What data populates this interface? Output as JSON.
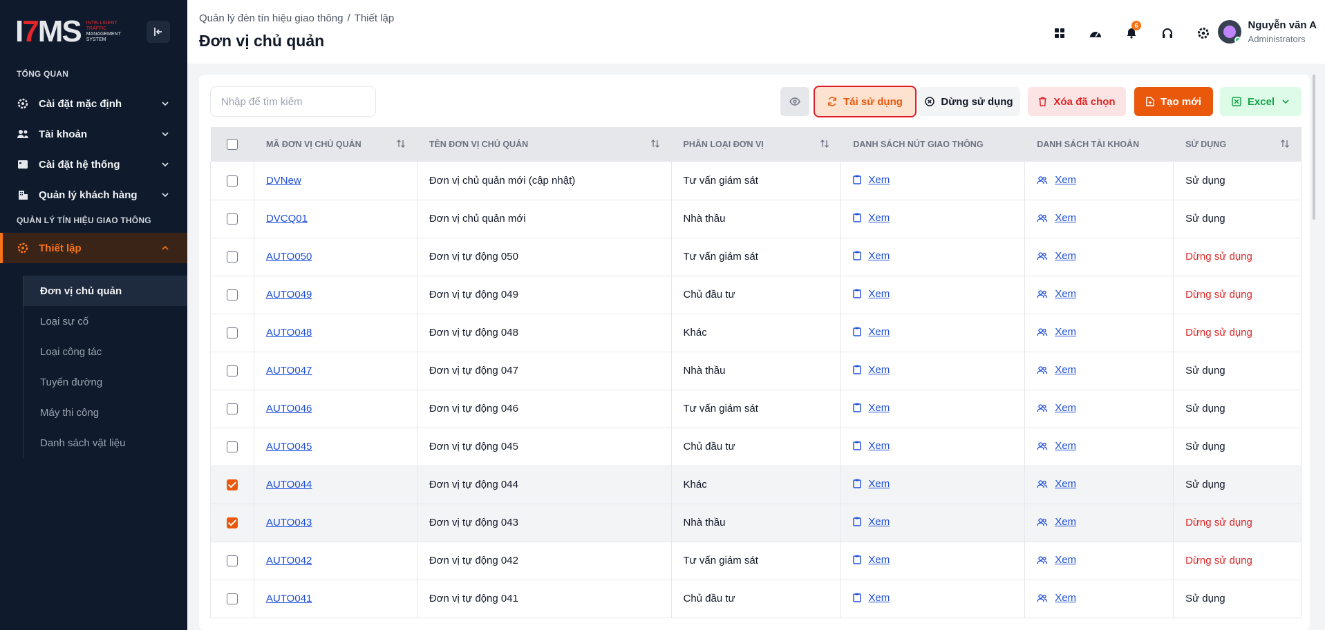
{
  "brand": {
    "logo_text": "ITMS",
    "logo_sub_red": "INTELLIGENT TRAFFIC",
    "logo_sub": "MANAGEMENT SYSTEM"
  },
  "sidebar": {
    "section1": "TỔNG QUAN",
    "items1": [
      {
        "label": "Cài đặt mặc định",
        "icon": "gear-icon"
      },
      {
        "label": "Tài khoản",
        "icon": "users-icon"
      },
      {
        "label": "Cài đặt hệ thống",
        "icon": "window-icon"
      },
      {
        "label": "Quản lý khách hàng",
        "icon": "building-icon"
      }
    ],
    "section2": "QUẢN LÝ TÍN HIỆU GIAO THÔNG",
    "active_item": {
      "label": "Thiết lập",
      "icon": "gear-icon"
    },
    "sub_items": [
      "Đơn vị chủ quản",
      "Loại sự cố",
      "Loại công tác",
      "Tuyến đường",
      "Máy thi công",
      "Danh sách vật liệu"
    ]
  },
  "header": {
    "breadcrumb": [
      "Quản lý đèn tín hiệu giao thông",
      "Thiết lập"
    ],
    "breadcrumb_sep": "/",
    "title": "Đơn vị chủ quản",
    "notification_count": "6",
    "user_name": "Nguyễn văn A",
    "user_role": "Administrators"
  },
  "toolbar": {
    "search_placeholder": "Nhập để tìm kiếm",
    "reuse": "Tái sử dụng",
    "stop": "Dừng sử dụng",
    "delete": "Xóa đã chọn",
    "create": "Tạo mới",
    "excel": "Excel"
  },
  "table": {
    "columns": [
      "MÃ ĐƠN VỊ CHỦ QUẢN",
      "TÊN ĐƠN VỊ CHỦ QUẢN",
      "PHÂN LOẠI ĐƠN VỊ",
      "DANH SÁCH NÚT GIAO THÔNG",
      "DANH SÁCH TÀI KHOẢN",
      "SỬ DỤNG"
    ],
    "view_label": "Xem",
    "rows": [
      {
        "code": "DVNew",
        "name": "Đơn vị chủ quản mới (cập nhật)",
        "type": "Tư vấn giám sát",
        "status": "Sử dụng",
        "active": true,
        "checked": false
      },
      {
        "code": "DVCQ01",
        "name": "Đơn vị chủ quản mới",
        "type": "Nhà thầu",
        "status": "Sử dụng",
        "active": true,
        "checked": false
      },
      {
        "code": "AUTO050",
        "name": "Đơn vị tự động 050",
        "type": "Tư vấn giám sát",
        "status": "Dừng sử dụng",
        "active": false,
        "checked": false
      },
      {
        "code": "AUTO049",
        "name": "Đơn vị tự động 049",
        "type": "Chủ đầu tư",
        "status": "Dừng sử dụng",
        "active": false,
        "checked": false
      },
      {
        "code": "AUTO048",
        "name": "Đơn vị tự động 048",
        "type": "Khác",
        "status": "Dừng sử dụng",
        "active": false,
        "checked": false
      },
      {
        "code": "AUTO047",
        "name": "Đơn vị tự động 047",
        "type": "Nhà thầu",
        "status": "Sử dụng",
        "active": true,
        "checked": false
      },
      {
        "code": "AUTO046",
        "name": "Đơn vị tự động 046",
        "type": "Tư vấn giám sát",
        "status": "Sử dụng",
        "active": true,
        "checked": false
      },
      {
        "code": "AUTO045",
        "name": "Đơn vị tự động 045",
        "type": "Chủ đầu tư",
        "status": "Sử dụng",
        "active": true,
        "checked": false
      },
      {
        "code": "AUTO044",
        "name": "Đơn vị tự động 044",
        "type": "Khác",
        "status": "Sử dụng",
        "active": true,
        "checked": true
      },
      {
        "code": "AUTO043",
        "name": "Đơn vị tự động 043",
        "type": "Nhà thầu",
        "status": "Dừng sử dụng",
        "active": false,
        "checked": true
      },
      {
        "code": "AUTO042",
        "name": "Đơn vị tự động 042",
        "type": "Tư vấn giám sát",
        "status": "Dừng sử dụng",
        "active": false,
        "checked": false
      },
      {
        "code": "AUTO041",
        "name": "Đơn vị tự động 041",
        "type": "Chủ đầu tư",
        "status": "Sử dụng",
        "active": true,
        "checked": false
      }
    ]
  },
  "colors": {
    "accent": "#ea580c",
    "sidebar_bg": "#0f1b2d",
    "link": "#1d4ed8",
    "danger": "#dc2626",
    "success": "#16a34a"
  }
}
